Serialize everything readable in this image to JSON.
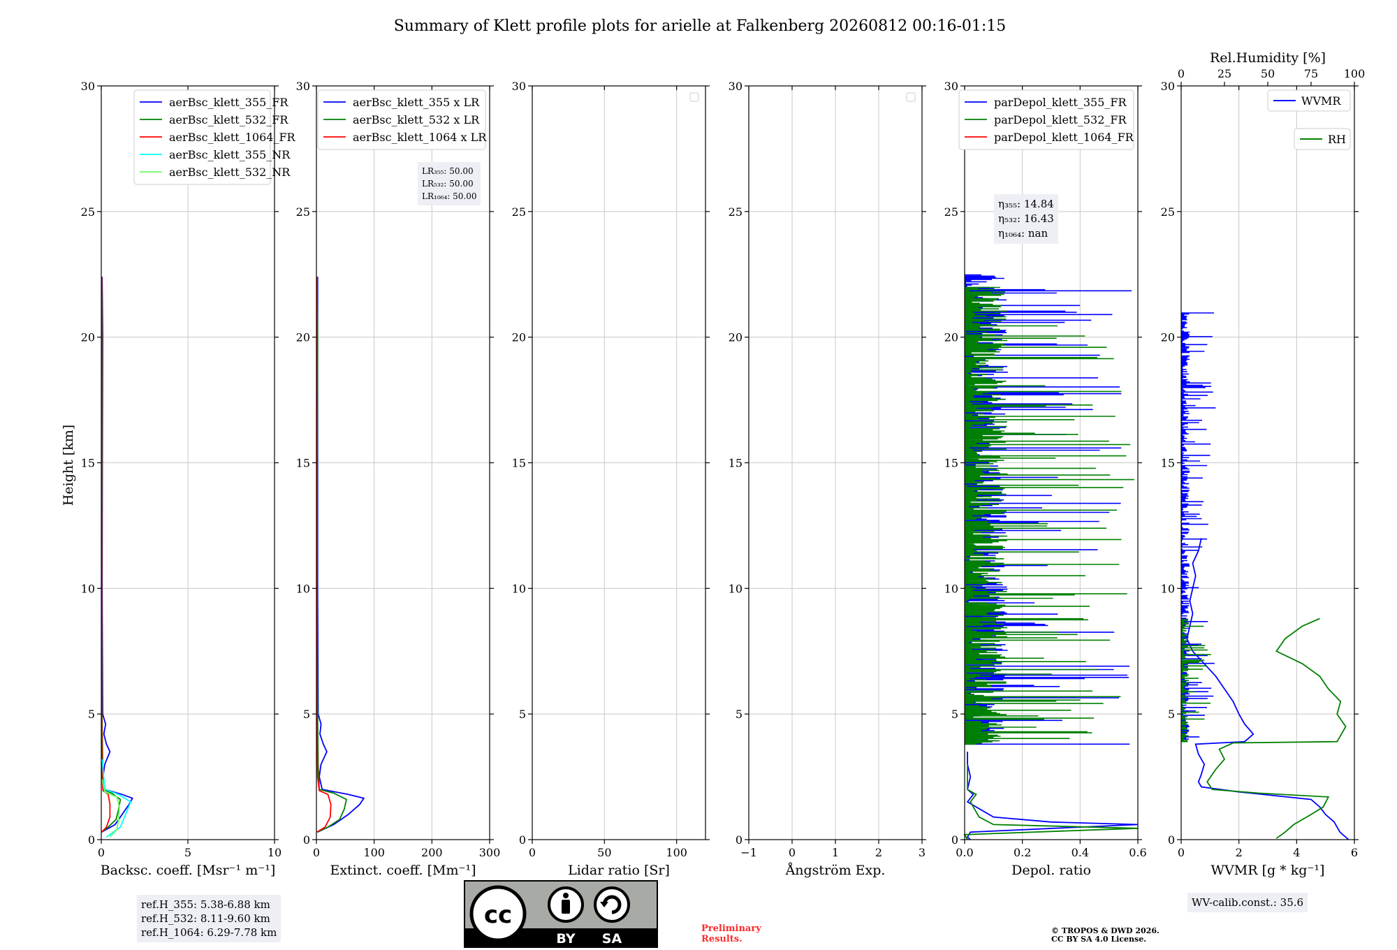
{
  "figure": {
    "title": "Summary of Klett profile plots for arielle at Falkenberg 20260812 00:16-01:15",
    "ylabel": "Height [km]",
    "ylim": [
      0,
      30
    ],
    "yticks": [
      0,
      5,
      10,
      15,
      20,
      25,
      30
    ]
  },
  "colors": {
    "c355": "#0000ff",
    "c532": "#008000",
    "c1064": "#ff0000",
    "c355nr": "#00ffff",
    "c532nr": "#66ff66",
    "box_bg": "#eeeff5",
    "preliminary": "#ff2a2a",
    "grid": "#c8c8c8"
  },
  "chart_data": [
    {
      "type": "line",
      "id": "bsc",
      "xlabel": "Backsc. coeff. [Msr⁻¹ m⁻¹]",
      "xlim": [
        0,
        10
      ],
      "xticks": [
        0,
        5,
        10
      ],
      "ylim": [
        0,
        30
      ],
      "legend": "top-right",
      "series": [
        {
          "name": "aerBsc_klett_355_FR",
          "color": "#0000ff",
          "profile": [
            [
              0.3,
              0.02
            ],
            [
              0.6,
              0.8
            ],
            [
              1.0,
              1.2
            ],
            [
              1.4,
              1.6
            ],
            [
              1.65,
              1.8
            ],
            [
              1.8,
              1.2
            ],
            [
              2.0,
              0.2
            ],
            [
              2.5,
              0.1
            ],
            [
              3.0,
              0.2
            ],
            [
              3.5,
              0.5
            ],
            [
              3.8,
              0.3
            ],
            [
              4.2,
              0.15
            ],
            [
              4.6,
              0.25
            ],
            [
              5.0,
              0.08
            ],
            [
              10.0,
              0.05
            ],
            [
              15.0,
              0.06
            ],
            [
              20.0,
              0.08
            ],
            [
              22.4,
              0.05
            ]
          ]
        },
        {
          "name": "aerBsc_klett_532_FR",
          "color": "#008000",
          "profile": [
            [
              0.3,
              0.02
            ],
            [
              0.5,
              0.4
            ],
            [
              0.8,
              0.85
            ],
            [
              1.2,
              1.0
            ],
            [
              1.6,
              1.1
            ],
            [
              1.85,
              0.6
            ],
            [
              2.0,
              0.1
            ],
            [
              3.0,
              0.08
            ],
            [
              5.0,
              0.04
            ],
            [
              10.0,
              0.03
            ],
            [
              15.0,
              0.04
            ],
            [
              20.0,
              0.05
            ],
            [
              22.4,
              0.03
            ]
          ]
        },
        {
          "name": "aerBsc_klett_1064_FR",
          "color": "#ff0000",
          "profile": [
            [
              0.3,
              0.02
            ],
            [
              0.5,
              0.3
            ],
            [
              0.9,
              0.5
            ],
            [
              1.4,
              0.5
            ],
            [
              1.8,
              0.4
            ],
            [
              1.95,
              0.1
            ],
            [
              2.5,
              0.04
            ],
            [
              5.0,
              0.02
            ],
            [
              10.0,
              0.02
            ],
            [
              20.0,
              0.02
            ],
            [
              22.4,
              0.02
            ]
          ]
        },
        {
          "name": "aerBsc_klett_355_NR",
          "color": "#00ffff",
          "profile": [
            [
              0.1,
              0.3
            ],
            [
              0.5,
              1.1
            ],
            [
              1.0,
              1.4
            ],
            [
              1.5,
              1.7
            ],
            [
              1.8,
              1.0
            ],
            [
              2.0,
              0.2
            ],
            [
              2.8,
              0.1
            ],
            [
              3.2,
              0.05
            ]
          ]
        },
        {
          "name": "aerBsc_klett_532_NR",
          "color": "#66ff66",
          "profile": [
            [
              0.1,
              0.5
            ],
            [
              0.4,
              0.9
            ],
            [
              0.8,
              1.0
            ],
            [
              1.3,
              1.05
            ],
            [
              1.7,
              0.9
            ],
            [
              1.9,
              0.2
            ],
            [
              2.4,
              0.05
            ]
          ]
        }
      ]
    },
    {
      "type": "line",
      "id": "ext",
      "xlabel": "Extinct. coeff. [Mm⁻¹]",
      "xlim": [
        0,
        300
      ],
      "xticks": [
        0,
        100,
        200,
        300
      ],
      "ylim": [
        0,
        30
      ],
      "legend": "top-right",
      "series": [
        {
          "name": "aerBsc_klett_355 x LR",
          "color": "#0000ff",
          "profile": [
            [
              0.3,
              2
            ],
            [
              0.6,
              30
            ],
            [
              1.0,
              55
            ],
            [
              1.4,
              75
            ],
            [
              1.65,
              82
            ],
            [
              1.8,
              55
            ],
            [
              2.0,
              10
            ],
            [
              2.5,
              5
            ],
            [
              3.0,
              8
            ],
            [
              3.5,
              18
            ],
            [
              3.8,
              12
            ],
            [
              4.2,
              6
            ],
            [
              4.6,
              8
            ],
            [
              5.0,
              3
            ],
            [
              10.0,
              2
            ],
            [
              15.0,
              2
            ],
            [
              20.0,
              2
            ],
            [
              22.4,
              2
            ]
          ]
        },
        {
          "name": "aerBsc_klett_532 x LR",
          "color": "#008000",
          "profile": [
            [
              0.3,
              2
            ],
            [
              0.5,
              20
            ],
            [
              0.8,
              40
            ],
            [
              1.2,
              48
            ],
            [
              1.6,
              52
            ],
            [
              1.85,
              30
            ],
            [
              2.0,
              5
            ],
            [
              3.0,
              3
            ],
            [
              5.0,
              2
            ],
            [
              10.0,
              1
            ],
            [
              20.0,
              2
            ],
            [
              22.4,
              1
            ]
          ]
        },
        {
          "name": "aerBsc_klett_1064 x LR",
          "color": "#ff0000",
          "profile": [
            [
              0.3,
              1
            ],
            [
              0.5,
              15
            ],
            [
              0.9,
              24
            ],
            [
              1.4,
              25
            ],
            [
              1.8,
              20
            ],
            [
              1.95,
              5
            ],
            [
              2.5,
              2
            ],
            [
              5.0,
              1
            ],
            [
              22.4,
              1
            ]
          ]
        }
      ]
    },
    {
      "type": "line",
      "id": "lr",
      "xlabel": "Lidar ratio [Sr]",
      "xlim": [
        0,
        120
      ],
      "xticks": [
        0,
        50,
        100
      ],
      "ylim": [
        0,
        30
      ],
      "legend": "top-right",
      "series": []
    },
    {
      "type": "line",
      "id": "ang",
      "xlabel": "Ångström Exp.",
      "xlim": [
        -1,
        3
      ],
      "xticks": [
        -1,
        0,
        1,
        2,
        3
      ],
      "ylim": [
        0,
        30
      ],
      "legend": "top-right",
      "series": []
    },
    {
      "type": "line",
      "id": "depol",
      "xlabel": "Depol. ratio",
      "xlim": [
        0,
        0.6
      ],
      "xticks": [
        0.0,
        0.2,
        0.4,
        0.6
      ],
      "ylim": [
        0,
        30
      ],
      "legend": "top-right",
      "series": [
        {
          "name": "parDepol_klett_355_FR",
          "color": "#0000ff",
          "profile": [
            [
              0.0,
              0.02
            ],
            [
              0.1,
              0.01
            ],
            [
              0.3,
              0.02
            ],
            [
              0.6,
              0.6
            ],
            [
              0.7,
              0.3
            ],
            [
              0.9,
              0.1
            ],
            [
              1.5,
              0.01
            ],
            [
              1.8,
              0.03
            ],
            [
              2.0,
              0.01
            ],
            [
              2.5,
              0.02
            ],
            [
              3.0,
              0.01
            ],
            [
              3.5,
              0.01
            ]
          ],
          "noise": [
            [
              3.8,
              22.5,
              0.6
            ]
          ]
        },
        {
          "name": "parDepol_klett_532_FR",
          "color": "#008000",
          "profile": [
            [
              0.0,
              0.01
            ],
            [
              0.2,
              0.0
            ],
            [
              0.45,
              0.6
            ],
            [
              0.6,
              0.1
            ],
            [
              0.9,
              0.05
            ],
            [
              1.5,
              0.02
            ],
            [
              1.8,
              0.04
            ],
            [
              2.0,
              0.01
            ],
            [
              3.0,
              0.01
            ]
          ],
          "noise": [
            [
              3.8,
              22.0,
              0.6
            ]
          ]
        },
        {
          "name": "parDepol_klett_1064_FR",
          "color": "#ff0000",
          "profile": []
        }
      ]
    },
    {
      "type": "line",
      "id": "wv",
      "xlabel": "WVMR [g * kg⁻¹]",
      "xlim": [
        0,
        6
      ],
      "xticks": [
        0,
        2,
        4,
        6
      ],
      "top_xlabel": "Rel.Humidity [%]",
      "top_xlim": [
        0,
        100
      ],
      "top_xticks": [
        0,
        25,
        50,
        75,
        100
      ],
      "ylim": [
        0,
        30
      ],
      "legend": "top-right",
      "series": [
        {
          "name": "WVMR",
          "color": "#0000ff",
          "axis": "bottom",
          "profile": [
            [
              0.0,
              5.8
            ],
            [
              0.3,
              5.5
            ],
            [
              0.7,
              5.3
            ],
            [
              1.0,
              5.0
            ],
            [
              1.3,
              4.8
            ],
            [
              1.6,
              4.5
            ],
            [
              1.9,
              2.0
            ],
            [
              2.1,
              0.7
            ],
            [
              2.3,
              0.6
            ],
            [
              2.6,
              0.7
            ],
            [
              3.0,
              0.8
            ],
            [
              3.4,
              0.6
            ],
            [
              3.8,
              0.5
            ],
            [
              3.9,
              2.2
            ],
            [
              4.2,
              2.5
            ],
            [
              4.6,
              2.2
            ],
            [
              5.0,
              2.0
            ],
            [
              5.5,
              1.8
            ],
            [
              6.0,
              1.5
            ],
            [
              6.5,
              1.2
            ],
            [
              7.0,
              0.8
            ],
            [
              7.5,
              0.4
            ],
            [
              8.0,
              0.2
            ],
            [
              8.5,
              0.3
            ],
            [
              9.0,
              0.4
            ],
            [
              9.5,
              0.3
            ],
            [
              10.0,
              0.4
            ],
            [
              10.5,
              0.5
            ],
            [
              11.0,
              0.4
            ],
            [
              11.5,
              0.6
            ],
            [
              12.0,
              0.7
            ]
          ],
          "noise": [
            [
              4.0,
              21.0,
              1.2
            ]
          ]
        },
        {
          "name": "RH",
          "color": "#008000",
          "axis": "top",
          "profile": [
            [
              0.05,
              55
            ],
            [
              0.3,
              60
            ],
            [
              0.6,
              65
            ],
            [
              1.0,
              75
            ],
            [
              1.3,
              82
            ],
            [
              1.7,
              85
            ],
            [
              1.85,
              45
            ],
            [
              2.0,
              18
            ],
            [
              2.3,
              15
            ],
            [
              2.8,
              20
            ],
            [
              3.2,
              25
            ],
            [
              3.6,
              22
            ],
            [
              3.85,
              30
            ],
            [
              3.9,
              90
            ],
            [
              4.5,
              95
            ],
            [
              5.0,
              90
            ],
            [
              5.5,
              92
            ],
            [
              6.0,
              85
            ],
            [
              6.5,
              80
            ],
            [
              7.0,
              70
            ],
            [
              7.5,
              55
            ],
            [
              8.0,
              60
            ],
            [
              8.5,
              70
            ],
            [
              8.8,
              80
            ]
          ],
          "noise": [
            [
              3.9,
              8.8,
              18
            ]
          ]
        }
      ]
    }
  ],
  "annotations": {
    "lr_box": [
      "LR₃₅₅: 50.00",
      "LR₅₃₂: 50.00",
      "LR₁₀₆₄: 50.00"
    ],
    "depol_box": [
      "η₃₅₅: 14.84",
      "η₅₃₂: 16.43",
      "η₁₀₆₄: nan"
    ],
    "refh_box": [
      "ref.H_355: 5.38-6.88 km",
      "ref.H_532: 8.11-9.60 km",
      "ref.H_1064: 6.29-7.78 km"
    ],
    "wv_box": [
      "WV-calib.const.: 35.6"
    ]
  },
  "footer": {
    "preliminary": [
      "Preliminary",
      "Results."
    ],
    "copyright": [
      "© TROPOS & DWD 2026.",
      "CC BY SA 4.0 License."
    ],
    "license_badge": {
      "cc": "cc",
      "by": "BY",
      "sa": "SA"
    }
  }
}
